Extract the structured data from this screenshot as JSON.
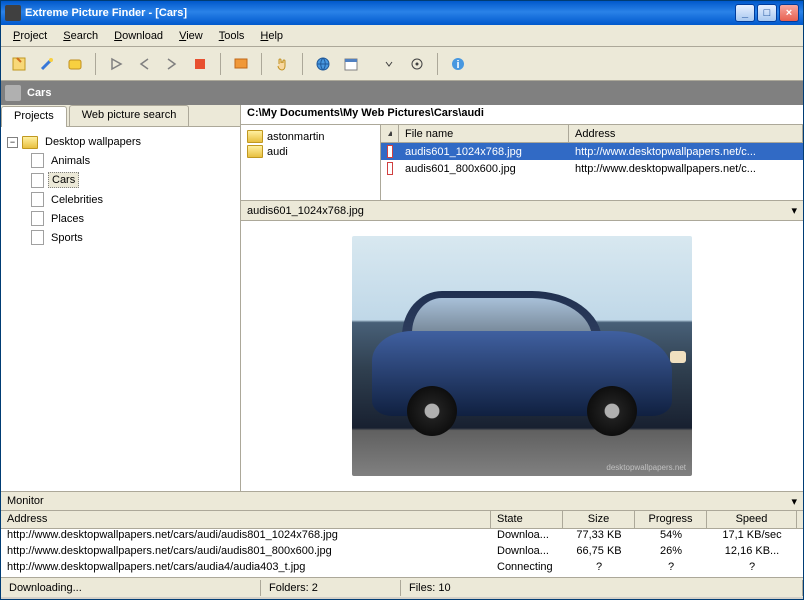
{
  "title": "Extreme Picture Finder - [Cars]",
  "menu": [
    "Project",
    "Search",
    "Download",
    "View",
    "Tools",
    "Help"
  ],
  "category": {
    "label": "Cars"
  },
  "left": {
    "tabs": {
      "projects": "Projects",
      "search": "Web picture search"
    },
    "root": "Desktop wallpapers",
    "items": [
      "Animals",
      "Cars",
      "Celebrities",
      "Places",
      "Sports"
    ],
    "selected": "Cars"
  },
  "path": "C:\\My Documents\\My Web Pictures\\Cars\\audi",
  "folders": [
    "astonmartin",
    "audi"
  ],
  "file_headers": {
    "name": "File name",
    "address": "Address"
  },
  "files": [
    {
      "name": "audis601_1024x768.jpg",
      "address": "http://www.desktopwallpapers.net/c..."
    },
    {
      "name": "audis601_800x600.jpg",
      "address": "http://www.desktopwallpapers.net/c..."
    }
  ],
  "selected_file_index": 0,
  "preview_name": "audis601_1024x768.jpg",
  "preview_brand": "desktopwallpapers.net",
  "monitor": {
    "title": "Monitor",
    "headers": {
      "address": "Address",
      "state": "State",
      "size": "Size",
      "progress": "Progress",
      "speed": "Speed"
    },
    "rows": [
      {
        "address": "http://www.desktopwallpapers.net/cars/audi/audis801_1024x768.jpg",
        "state": "Downloa...",
        "size": "77,33 KB",
        "progress": "54%",
        "speed": "17,1 KB/sec"
      },
      {
        "address": "http://www.desktopwallpapers.net/cars/audi/audis801_800x600.jpg",
        "state": "Downloa...",
        "size": "66,75 KB",
        "progress": "26%",
        "speed": "12,16 KB..."
      },
      {
        "address": "http://www.desktopwallpapers.net/cars/audia4/audia403_t.jpg",
        "state": "Connecting",
        "size": "?",
        "progress": "?",
        "speed": "?"
      }
    ]
  },
  "status": {
    "state": "Downloading...",
    "folders": "Folders: 2",
    "files": "Files: 10"
  }
}
